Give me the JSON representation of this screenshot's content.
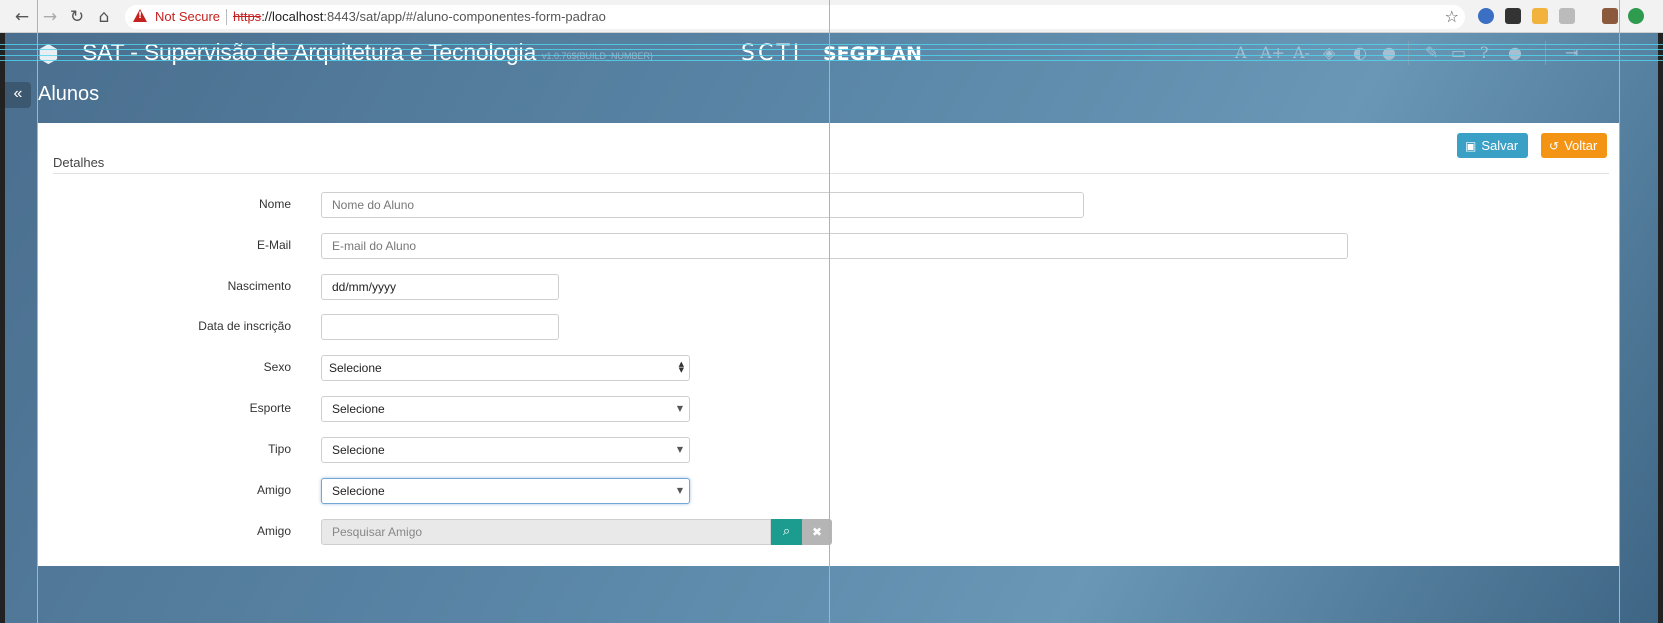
{
  "browser": {
    "back_icon": "arrow-left-icon",
    "forward_icon": "arrow-right-icon",
    "reload_icon": "reload-icon",
    "home_icon": "home-icon",
    "security_label": "Not Secure",
    "url_scheme": "https",
    "url_host": "://localhost",
    "url_rest": ":8443/sat/app/#/aluno-componentes-form-padrao",
    "bookmark_icon": "star-icon"
  },
  "header": {
    "title": "SAT - Supervisão de Arquitetura e Tecnologia",
    "version": "v1.0.76${BUILD_NUMBER}",
    "brand_scti": "SCTI",
    "brand_segplan": "SEGPLAN",
    "accessibility_tools": [
      "A",
      "A+",
      "A-"
    ]
  },
  "page": {
    "collapse_icon": "double-chevron-left-icon",
    "title": "Alunos"
  },
  "actions": {
    "save_label": "Salvar",
    "back_label": "Voltar"
  },
  "form": {
    "section_title": "Detalhes",
    "nome": {
      "label": "Nome",
      "placeholder": "Nome do Aluno"
    },
    "email": {
      "label": "E-Mail",
      "placeholder": "E-mail do Aluno"
    },
    "nascimento": {
      "label": "Nascimento",
      "value": "dd/mm/yyyy"
    },
    "inscricao": {
      "label": "Data de inscrição",
      "value": ""
    },
    "sexo": {
      "label": "Sexo",
      "selected": "Selecione"
    },
    "esporte": {
      "label": "Esporte",
      "selected": "Selecione"
    },
    "tipo": {
      "label": "Tipo",
      "selected": "Selecione"
    },
    "amigo": {
      "label": "Amigo",
      "selected": "Selecione"
    },
    "amigo_search": {
      "label": "Amigo",
      "placeholder": "Pesquisar Amigo"
    }
  },
  "colors": {
    "save": "#3aa0c5",
    "back": "#f39415",
    "search": "#1c9c8e",
    "header_bg": "#5b87a8"
  }
}
